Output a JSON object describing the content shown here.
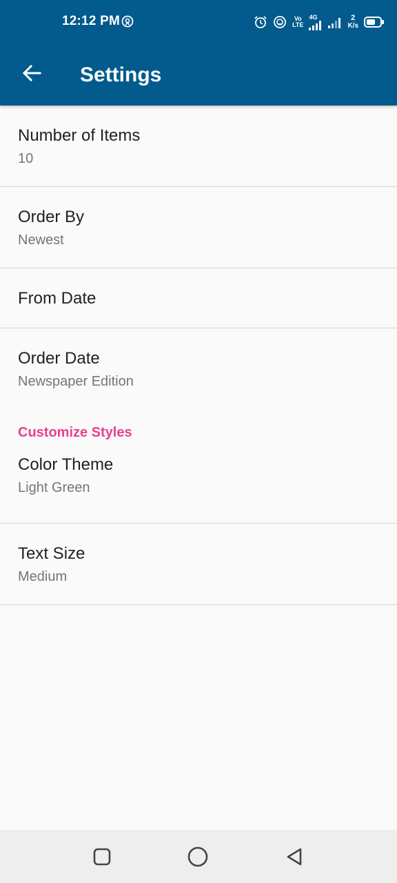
{
  "status_bar": {
    "time": "12:12 PM",
    "network_badge_top": "Vo",
    "network_badge_bottom": "LTE",
    "network_type": "4G",
    "speed_value": "2",
    "speed_unit": "K/s"
  },
  "app_bar": {
    "title": "Settings",
    "background_color": "#025a8d"
  },
  "settings": {
    "number_of_items": {
      "title": "Number of Items",
      "value": "10"
    },
    "order_by": {
      "title": "Order By",
      "value": "Newest"
    },
    "from_date": {
      "title": "From Date"
    },
    "order_date": {
      "title": "Order Date",
      "value": "Newspaper Edition"
    },
    "customize_styles": {
      "label": "Customize Styles",
      "color": "#e8418b"
    },
    "color_theme": {
      "title": "Color Theme",
      "value": "Light Green"
    },
    "text_size": {
      "title": "Text Size",
      "value": "Medium"
    }
  },
  "nav_bar": {
    "icons": [
      "recents-square-icon",
      "home-circle-icon",
      "back-triangle-icon"
    ]
  }
}
